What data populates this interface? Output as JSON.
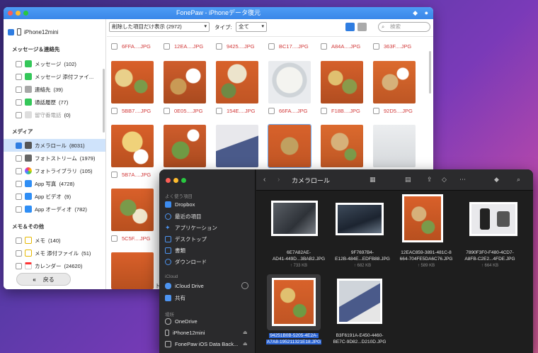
{
  "fonepaw": {
    "title": "FonePaw - iPhoneデータ復元",
    "device_name": "iPhone12mini",
    "sections": {
      "messages": "メッセージ＆連絡先",
      "media": "メディア",
      "memo": "メモ＆その他"
    },
    "sidebar_items": [
      {
        "label": "メッセージ",
        "count": "(102)"
      },
      {
        "label": "メッセージ 添付ファイ...",
        "count": ""
      },
      {
        "label": "連絡先",
        "count": "(39)"
      },
      {
        "label": "通話履歴",
        "count": "(77)"
      },
      {
        "label": "留守番電話",
        "count": "(0)"
      },
      {
        "label": "カメラロール",
        "count": "(8031)"
      },
      {
        "label": "フォトストリーム",
        "count": "(1979)"
      },
      {
        "label": "フォトライブラリ",
        "count": "(105)"
      },
      {
        "label": "App 写真",
        "count": "(4728)"
      },
      {
        "label": "App ビデオ",
        "count": "(9)"
      },
      {
        "label": "App オーディオ",
        "count": "(782)"
      },
      {
        "label": "メモ",
        "count": "(140)"
      },
      {
        "label": "メモ 添付ファイル",
        "count": "(51)"
      },
      {
        "label": "カレンダー",
        "count": "(24620)"
      }
    ],
    "back_label": "戻る",
    "filter_select": "削除した項目だけ表示 (2972)",
    "type_label": "タイプ:",
    "type_select": "全て",
    "search_placeholder": "検索",
    "row1_captions": [
      "6FFA....JPG",
      "12EA....JPG",
      "9425....JPG",
      "BC17....JPG",
      "A84A....JPG",
      "363F....JPG"
    ],
    "row2_captions": [
      "5BB7....JPG",
      "0E05....JPG",
      "154E....JPG",
      "66FA....JPG",
      "F18B....JPG",
      "92D5....JPG"
    ],
    "row3_captions": [
      "5B7A....JPG"
    ],
    "row4_captions": [
      "5C5F....JPG"
    ],
    "caption_color": "#d23a3a",
    "accent": "#3a87e8",
    "partial_text": "ト"
  },
  "finder": {
    "folder_title": "カメラロール",
    "favorites_heading": "よく使う項目",
    "favorites": [
      "Dropbox",
      "最近の項目",
      "アプリケーション",
      "デスクトップ",
      "書類",
      "ダウンロード"
    ],
    "icloud_heading": "iCloud",
    "icloud_items": [
      "iCloud Drive",
      "共有"
    ],
    "places_heading": "場所",
    "places": [
      "OneDrive",
      "iPhone12mini",
      "FonePaw iOS Data Back..."
    ],
    "files": [
      {
        "name1": "6E7A82AE-",
        "name2": "AD41-449D...3BAB2.JPG",
        "size": "↑ 733 KB"
      },
      {
        "name1": "9F7697B4-",
        "name2": "E12B-484E...EDFB88.JPG",
        "size": "↑ 682 KB"
      },
      {
        "name1": "12EAC859-3891-481C-8",
        "name2": "664-704FE5DA6C76.JPG",
        "size": "↑ 589 KB"
      },
      {
        "name1": "7890F3F0-F480-4CD7-",
        "name2": "A8FB-C2E2...4FDE.JPG",
        "size": "↑ 664 KB"
      },
      {
        "name1": "94251B0B-5205-4E2A-",
        "name2": "A7A8-195211321E18.JPG",
        "size": ""
      },
      {
        "name1": "B3F6191A-E450-4460-",
        "name2": "BE7C-9D82...D210D.JPG",
        "size": ""
      }
    ],
    "selection_color": "#2a64d4"
  }
}
